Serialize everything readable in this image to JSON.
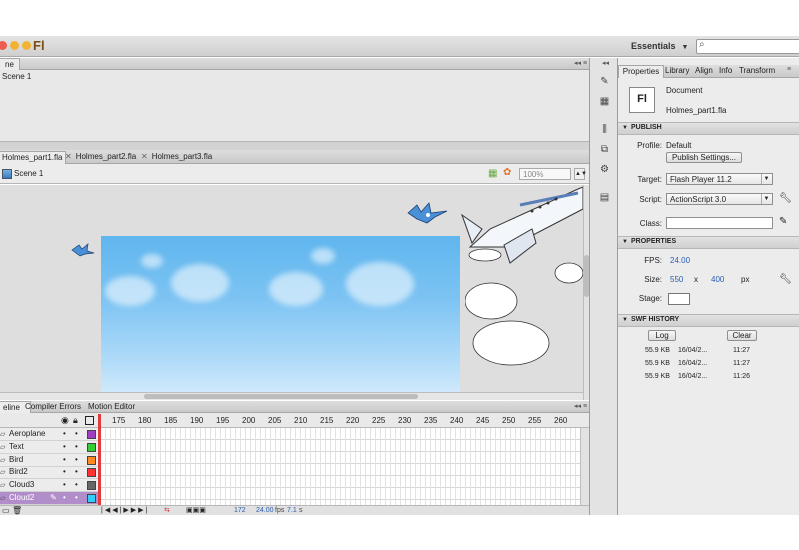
{
  "app": {
    "logo": "Fl",
    "workspace": "Essentials",
    "search_placeholder": ""
  },
  "motion_panel": {
    "tab": "ne",
    "breadcrumb": "Scene 1"
  },
  "doc_tabs": [
    {
      "label": "Holmes_part1.fla",
      "active": true
    },
    {
      "label": "Holmes_part2.fla",
      "active": false
    },
    {
      "label": "Holmes_part3.fla",
      "active": false
    }
  ],
  "edit_bar": {
    "scene": "Scene 1",
    "zoom": "100%"
  },
  "timeline": {
    "tabs": [
      "eline",
      "Compiler Errors",
      "Motion Editor"
    ],
    "frame_numbers": [
      "175",
      "180",
      "185",
      "190",
      "195",
      "200",
      "205",
      "210",
      "215",
      "220",
      "225",
      "230",
      "235",
      "240",
      "245",
      "250",
      "255",
      "260"
    ],
    "layers": [
      {
        "name": "Aeroplane",
        "color": "#a23cc4",
        "selected": false
      },
      {
        "name": "Text",
        "color": "#33cc33",
        "selected": false
      },
      {
        "name": "Bird",
        "color": "#ff8a1f",
        "selected": false
      },
      {
        "name": "Bird2",
        "color": "#ff3333",
        "selected": false
      },
      {
        "name": "Cloud3",
        "color": "#666666",
        "selected": false
      },
      {
        "name": "Cloud2",
        "color": "#33ccff",
        "selected": true
      }
    ],
    "footer": {
      "frame": "172",
      "fps": "24.00",
      "fps_unit": "fps",
      "time": "7.1",
      "time_unit": "s"
    }
  },
  "properties": {
    "tabs": [
      "Properties",
      "Library",
      "Align",
      "Info",
      "Transform"
    ],
    "doc_icon": "Fl",
    "doc_type": "Document",
    "doc_name": "Holmes_part1.fla",
    "publish": {
      "header": "PUBLISH",
      "profile_label": "Profile:",
      "profile_value": "Default",
      "publish_settings": "Publish Settings...",
      "target_label": "Target:",
      "target_value": "Flash Player 11.2",
      "script_label": "Script:",
      "script_value": "ActionScript 3.0",
      "class_label": "Class:"
    },
    "props": {
      "header": "PROPERTIES",
      "fps_label": "FPS:",
      "fps_value": "24.00",
      "size_label": "Size:",
      "width": "550",
      "x": "x",
      "height": "400",
      "unit": "px",
      "stage_label": "Stage:"
    },
    "swf_history": {
      "header": "SWF HISTORY",
      "log": "Log",
      "clear": "Clear",
      "rows": [
        {
          "size": "55.9 KB",
          "date": "16/04/2...",
          "time": "11:27"
        },
        {
          "size": "55.9 KB",
          "date": "16/04/2...",
          "time": "11:27"
        },
        {
          "size": "55.9 KB",
          "date": "16/04/2...",
          "time": "11:26"
        }
      ]
    }
  },
  "colors": {
    "selected_layer": "#b18ec9",
    "link_blue": "#2a5db0",
    "playhead": "#e23b3b"
  }
}
